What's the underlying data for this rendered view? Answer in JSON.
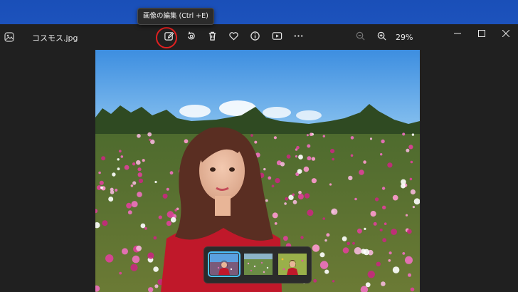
{
  "app": {
    "filename": "コスモス.jpg",
    "icon": "photos-app-icon"
  },
  "tooltip": {
    "text": "画像の編集 (Ctrl +E)"
  },
  "toolbar": {
    "items": [
      "edit-image-icon",
      "rotate-icon",
      "delete-icon",
      "favorite-icon",
      "info-icon",
      "slideshow-icon",
      "more-icon"
    ],
    "zoom_out_icon": "zoom-out-icon",
    "zoom_in_icon": "zoom-in-icon",
    "zoom_level": "29%"
  },
  "window_controls": [
    "minimize-icon",
    "maximize-icon",
    "close-icon"
  ],
  "filmstrip": {
    "thumbnail_count": 3,
    "selected_index": 0
  },
  "colors": {
    "background": "#202020",
    "highlight": "#e02020",
    "accent": "#4cc2ff"
  }
}
